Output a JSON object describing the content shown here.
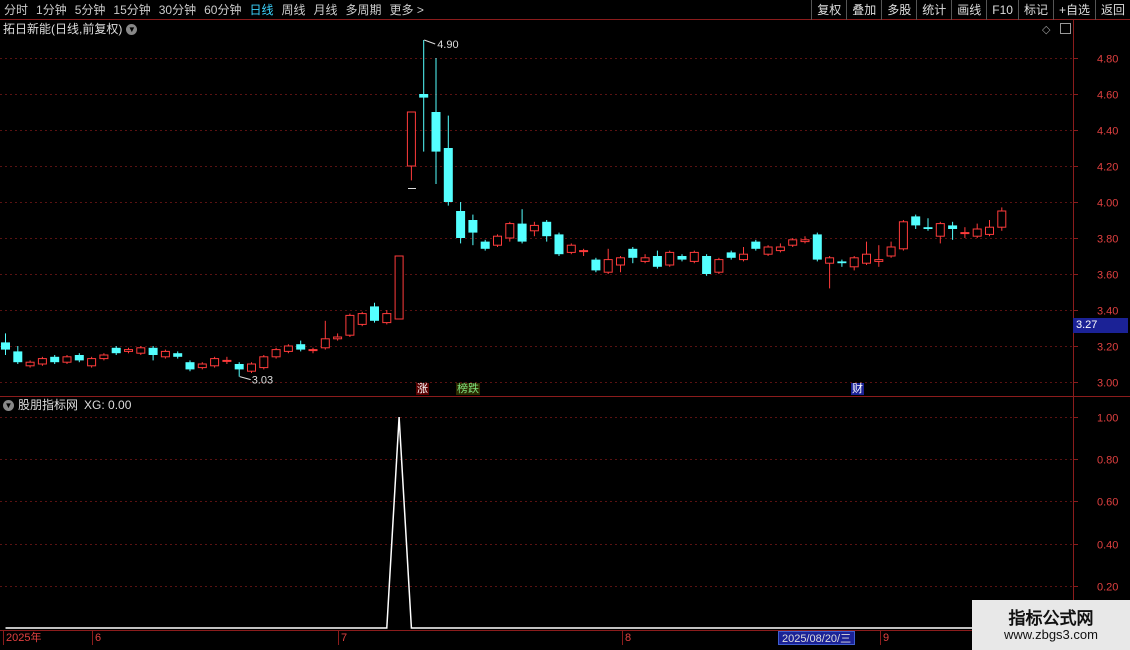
{
  "toolbar": {
    "periods": [
      "分时",
      "1分钟",
      "5分钟",
      "15分钟",
      "30分钟",
      "60分钟",
      "日线",
      "周线",
      "月线",
      "多周期",
      "更多"
    ],
    "active_period": "日线",
    "more_arrow": ">",
    "right_buttons": [
      "复权",
      "叠加",
      "多股",
      "统计",
      "画线",
      "F10",
      "标记",
      "+自选",
      "返回"
    ]
  },
  "main_panel": {
    "title": "拓日新能(日线,前复权)",
    "expand_icon": "chevron-down-icon",
    "high_label": "4.90",
    "low_label": "3.03",
    "current_price": "3.27",
    "y_ticks": [
      "4.80",
      "4.60",
      "4.40",
      "4.20",
      "4.00",
      "3.80",
      "3.60",
      "3.40",
      "3.20",
      "3.00"
    ],
    "markers": [
      {
        "text": "涨",
        "color": "#ff3030"
      },
      {
        "text": "榜跌",
        "color": "#50e050"
      },
      {
        "text": "财",
        "color": "#fff"
      }
    ]
  },
  "indicator_panel": {
    "title": "股朋指标网",
    "value_label": "XG: 0.00",
    "y_ticks": [
      "1.00",
      "0.80",
      "0.60",
      "0.40",
      "0.20"
    ]
  },
  "date_axis": {
    "labels": [
      "2025年",
      "6",
      "7",
      "8",
      "9"
    ],
    "cursor_date": "2025/08/20/三"
  },
  "watermark": {
    "title": "指标公式网",
    "url": "www.zbgs3.com"
  },
  "chart_data": [
    {
      "type": "candlestick",
      "title": "拓日新能(日线,前复权)",
      "ylim": [
        2.95,
        5.0
      ],
      "y_ticks": [
        3.0,
        3.2,
        3.4,
        3.6,
        3.8,
        4.0,
        4.2,
        4.4,
        4.6,
        4.8
      ],
      "candles": [
        [
          3.22,
          3.18,
          3.27,
          3.15
        ],
        [
          3.17,
          3.11,
          3.2,
          3.1
        ],
        [
          3.09,
          3.11,
          3.12,
          3.08
        ],
        [
          3.1,
          3.13,
          3.14,
          3.09
        ],
        [
          3.14,
          3.11,
          3.15,
          3.1
        ],
        [
          3.11,
          3.14,
          3.15,
          3.1
        ],
        [
          3.15,
          3.12,
          3.16,
          3.11
        ],
        [
          3.09,
          3.13,
          3.14,
          3.08
        ],
        [
          3.13,
          3.15,
          3.16,
          3.12
        ],
        [
          3.19,
          3.16,
          3.2,
          3.15
        ],
        [
          3.17,
          3.18,
          3.19,
          3.16
        ],
        [
          3.16,
          3.19,
          3.2,
          3.15
        ],
        [
          3.19,
          3.15,
          3.2,
          3.12
        ],
        [
          3.14,
          3.17,
          3.18,
          3.13
        ],
        [
          3.16,
          3.14,
          3.17,
          3.13
        ],
        [
          3.11,
          3.07,
          3.12,
          3.06
        ],
        [
          3.08,
          3.1,
          3.11,
          3.07
        ],
        [
          3.09,
          3.13,
          3.14,
          3.08
        ],
        [
          3.12,
          3.12,
          3.14,
          3.1
        ],
        [
          3.1,
          3.07,
          3.11,
          3.03
        ],
        [
          3.06,
          3.1,
          3.11,
          3.05
        ],
        [
          3.08,
          3.14,
          3.15,
          3.07
        ],
        [
          3.14,
          3.18,
          3.19,
          3.13
        ],
        [
          3.17,
          3.2,
          3.21,
          3.16
        ],
        [
          3.21,
          3.18,
          3.23,
          3.17
        ],
        [
          3.18,
          3.18,
          3.19,
          3.16
        ],
        [
          3.19,
          3.24,
          3.34,
          3.18
        ],
        [
          3.24,
          3.25,
          3.27,
          3.23
        ],
        [
          3.26,
          3.37,
          3.38,
          3.25
        ],
        [
          3.32,
          3.38,
          3.39,
          3.31
        ],
        [
          3.42,
          3.34,
          3.44,
          3.33
        ],
        [
          3.33,
          3.38,
          3.4,
          3.32
        ],
        [
          3.35,
          3.7,
          3.7,
          3.35
        ],
        [
          4.2,
          4.5,
          4.5,
          4.12
        ],
        [
          4.6,
          4.58,
          4.9,
          4.28
        ],
        [
          4.5,
          4.28,
          4.8,
          4.1
        ],
        [
          4.3,
          4.0,
          4.48,
          3.98
        ],
        [
          3.95,
          3.8,
          4.0,
          3.77
        ],
        [
          3.9,
          3.83,
          3.93,
          3.76
        ],
        [
          3.78,
          3.74,
          3.79,
          3.73
        ],
        [
          3.76,
          3.81,
          3.82,
          3.75
        ],
        [
          3.8,
          3.88,
          3.89,
          3.78
        ],
        [
          3.88,
          3.78,
          3.96,
          3.77
        ],
        [
          3.84,
          3.87,
          3.89,
          3.81
        ],
        [
          3.89,
          3.81,
          3.9,
          3.78
        ],
        [
          3.82,
          3.71,
          3.83,
          3.7
        ],
        [
          3.72,
          3.76,
          3.77,
          3.71
        ],
        [
          3.73,
          3.73,
          3.74,
          3.7
        ],
        [
          3.68,
          3.62,
          3.69,
          3.61
        ],
        [
          3.61,
          3.68,
          3.74,
          3.6
        ],
        [
          3.65,
          3.69,
          3.7,
          3.61
        ],
        [
          3.74,
          3.69,
          3.75,
          3.66
        ],
        [
          3.67,
          3.69,
          3.71,
          3.66
        ],
        [
          3.7,
          3.64,
          3.73,
          3.63
        ],
        [
          3.65,
          3.72,
          3.73,
          3.64
        ],
        [
          3.7,
          3.68,
          3.71,
          3.67
        ],
        [
          3.67,
          3.72,
          3.73,
          3.66
        ],
        [
          3.7,
          3.6,
          3.71,
          3.59
        ],
        [
          3.61,
          3.68,
          3.69,
          3.6
        ],
        [
          3.72,
          3.69,
          3.73,
          3.68
        ],
        [
          3.68,
          3.71,
          3.75,
          3.67
        ],
        [
          3.78,
          3.74,
          3.79,
          3.73
        ],
        [
          3.71,
          3.75,
          3.76,
          3.7
        ],
        [
          3.73,
          3.75,
          3.77,
          3.72
        ],
        [
          3.76,
          3.79,
          3.8,
          3.75
        ],
        [
          3.78,
          3.79,
          3.81,
          3.77
        ],
        [
          3.82,
          3.68,
          3.83,
          3.67
        ],
        [
          3.66,
          3.69,
          3.7,
          3.52
        ],
        [
          3.67,
          3.66,
          3.68,
          3.64
        ],
        [
          3.64,
          3.69,
          3.7,
          3.62
        ],
        [
          3.66,
          3.71,
          3.78,
          3.65
        ],
        [
          3.67,
          3.68,
          3.76,
          3.64
        ],
        [
          3.7,
          3.75,
          3.78,
          3.69
        ],
        [
          3.74,
          3.89,
          3.9,
          3.73
        ],
        [
          3.92,
          3.87,
          3.93,
          3.85
        ],
        [
          3.86,
          3.85,
          3.91,
          3.84
        ],
        [
          3.81,
          3.88,
          3.89,
          3.77
        ],
        [
          3.87,
          3.85,
          3.89,
          3.79
        ],
        [
          3.83,
          3.83,
          3.86,
          3.8
        ],
        [
          3.81,
          3.85,
          3.88,
          3.8
        ],
        [
          3.82,
          3.86,
          3.9,
          3.81
        ],
        [
          3.86,
          3.95,
          3.97,
          3.84
        ]
      ]
    },
    {
      "type": "line",
      "title": "股朋指标网",
      "series": [
        {
          "name": "XG",
          "values": [
            0,
            0,
            0,
            0,
            0,
            0,
            0,
            0,
            0,
            0,
            0,
            0,
            0,
            0,
            0,
            0,
            0,
            0,
            0,
            0,
            0,
            0,
            0,
            0,
            0,
            0,
            0,
            0,
            0,
            0,
            0,
            0,
            1,
            0,
            0,
            0,
            0,
            0,
            0,
            0,
            0,
            0,
            0,
            0,
            0,
            0,
            0,
            0,
            0,
            0,
            0,
            0,
            0,
            0,
            0,
            0,
            0,
            0,
            0,
            0,
            0,
            0,
            0,
            0,
            0,
            0,
            0,
            0,
            0,
            0,
            0,
            0,
            0,
            0,
            0,
            0,
            0,
            0,
            0,
            0,
            0,
            0
          ]
        }
      ],
      "ylim": [
        0,
        1.0
      ]
    }
  ]
}
